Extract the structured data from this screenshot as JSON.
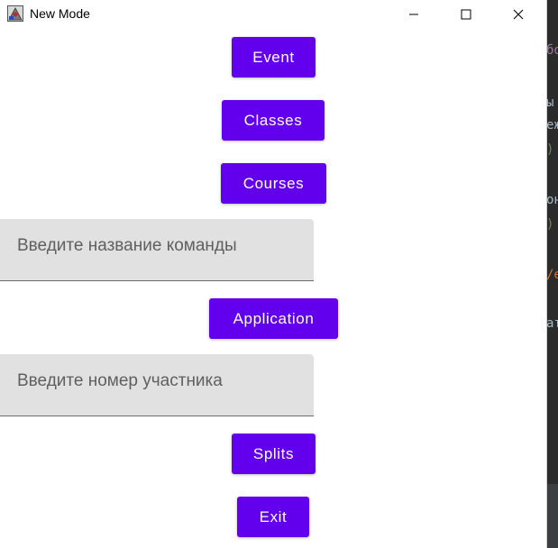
{
  "window": {
    "title": "New Mode",
    "controls": {
      "minimize": "—",
      "maximize": "☐",
      "close": "✕"
    }
  },
  "buttons": {
    "event": "Event",
    "classes": "Classes",
    "courses": "Courses",
    "application": "Application",
    "splits": "Splits",
    "exit": "Exit"
  },
  "fields": {
    "team_name": {
      "value": "",
      "placeholder": "Введите название команды"
    },
    "participant_number": {
      "value": "",
      "placeholder": "Введите номер участника"
    }
  },
  "background_editor": {
    "fragments": [
      "бо",
      "ы",
      "еж",
      ")",
      "он",
      ")",
      "/е",
      "ат"
    ]
  },
  "colors": {
    "accent": "#6200ee",
    "button_text": "#ffffff",
    "field_background": "#e1e1e1",
    "editor_background": "#2b2b2b"
  }
}
